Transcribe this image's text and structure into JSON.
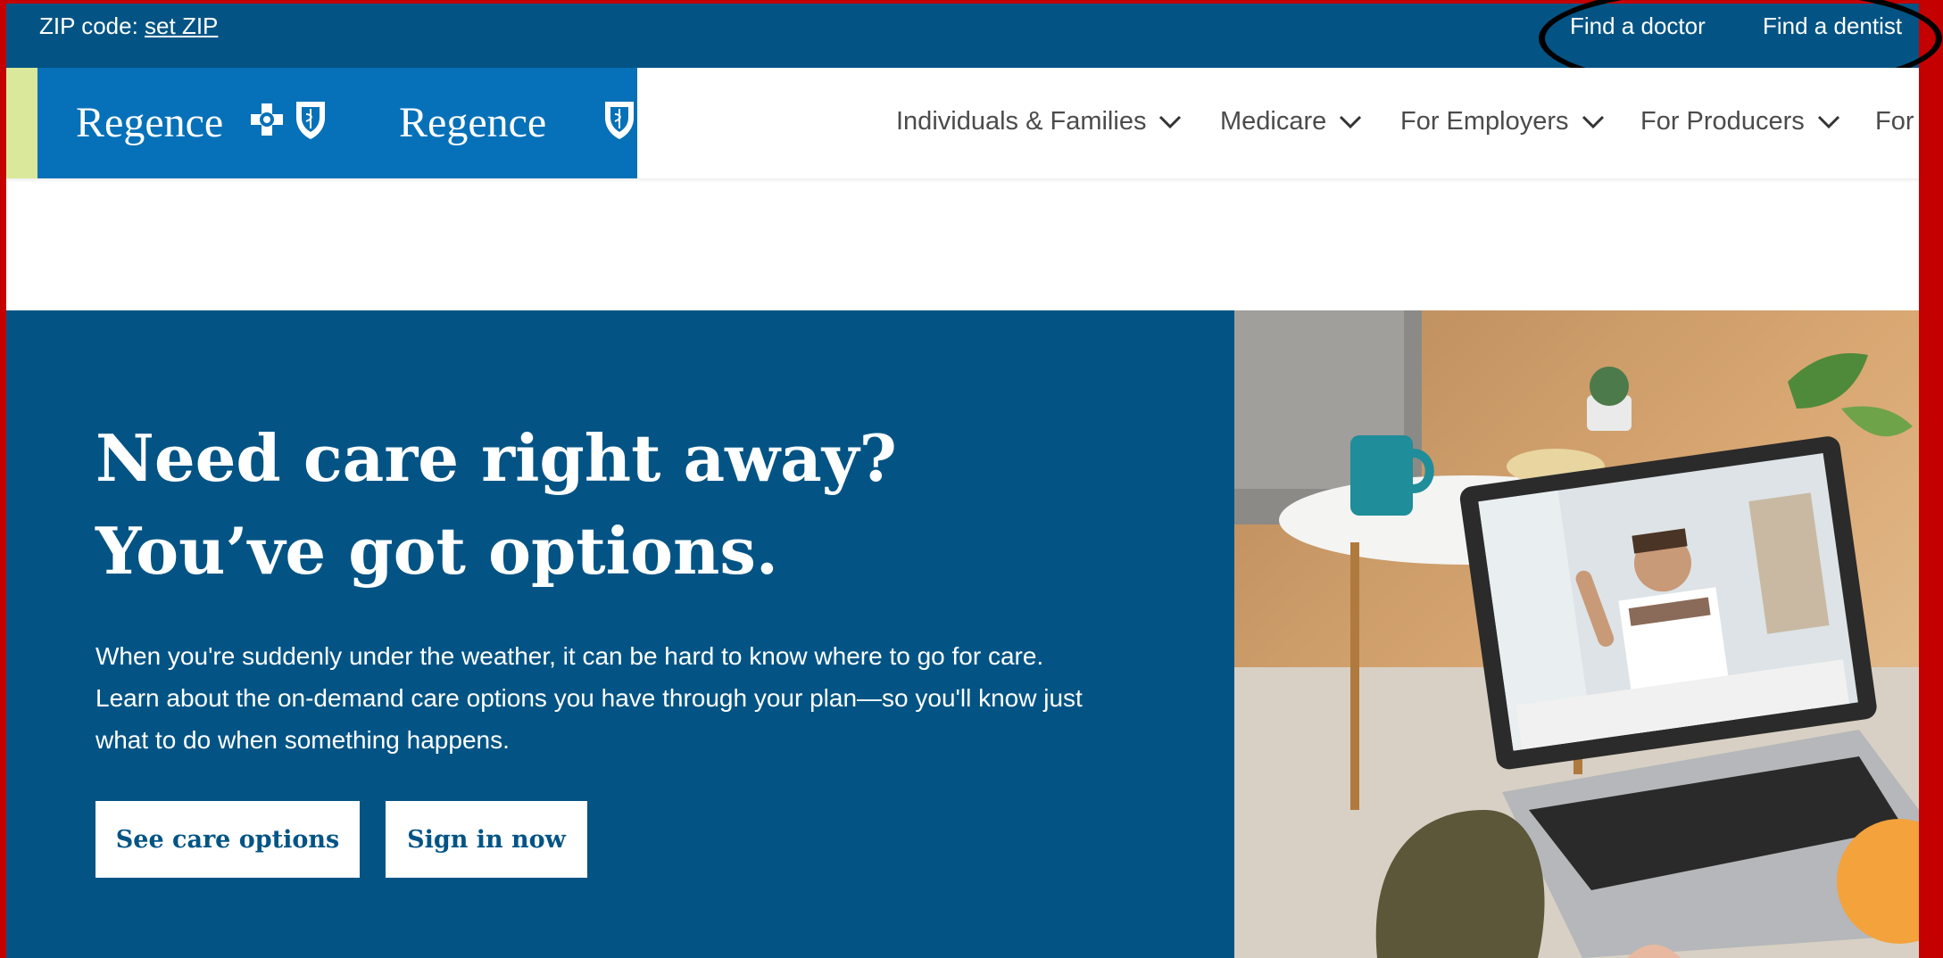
{
  "utility_bar": {
    "zip_label": "ZIP code:",
    "zip_link": "set ZIP",
    "links": [
      "Find a doctor",
      "Find a dentist"
    ]
  },
  "header": {
    "logos": [
      "Regence",
      "Regence"
    ],
    "nav": [
      "Individuals & Families",
      "Medicare",
      "For Employers",
      "For Producers",
      "For"
    ]
  },
  "hero": {
    "title_line1": "Need care right away?",
    "title_line2": "You’ve got options.",
    "body_line1": "When you're suddenly under the weather, it can be hard to know where to go for care.",
    "body_line2": "Learn about the on-demand care options you have through your plan—so you'll know just",
    "body_line3": "what to do when something happens.",
    "buttons": [
      "See care options",
      "Sign in now"
    ]
  },
  "colors": {
    "brand_navy": "#035485",
    "brand_blue": "#0671b8",
    "accent_green": "#d9e89a",
    "annotation_red": "#c40000"
  },
  "icons": [
    "blue-cross-icon",
    "blue-shield-icon",
    "chevron-down-icon"
  ]
}
